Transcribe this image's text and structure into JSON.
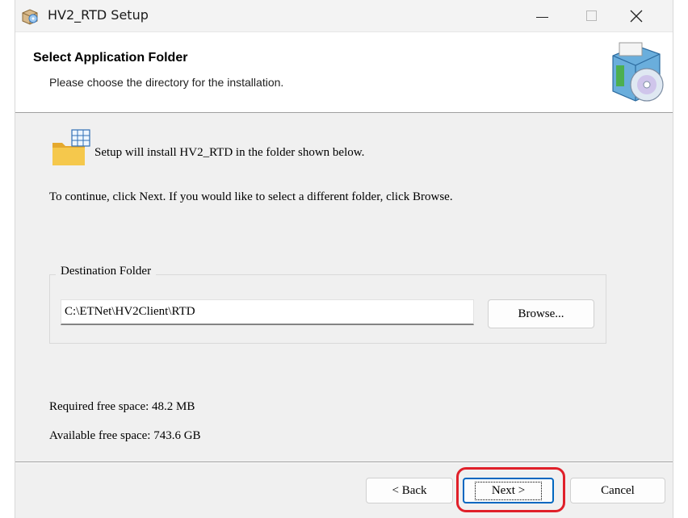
{
  "window": {
    "title": "HV2_RTD Setup"
  },
  "header": {
    "title": "Select Application Folder",
    "subtitle": "Please choose the directory for the installation."
  },
  "body": {
    "install_text": "Setup will install HV2_RTD in the folder shown below.",
    "continue_text": "To continue, click Next. If you would like to select a different folder, click Browse.",
    "destination": {
      "label": "Destination Folder",
      "path": "C:\\ETNet\\HV2Client\\RTD",
      "browse_label": "Browse..."
    },
    "required_space": "Required free space: 48.2 MB",
    "available_space": "Available free space: 743.6 GB"
  },
  "footer": {
    "back_label": "< Back",
    "next_label": "Next >",
    "cancel_label": "Cancel"
  },
  "colors": {
    "highlight": "#e0202a",
    "focus_border": "#0067c0",
    "folder": "#f5c84c"
  },
  "icons": {
    "app": "installer-box-icon",
    "header": "setup-box-cd-icon",
    "folder": "folder-grid-icon",
    "window_controls": [
      "minimize-icon",
      "maximize-icon",
      "close-icon"
    ]
  }
}
